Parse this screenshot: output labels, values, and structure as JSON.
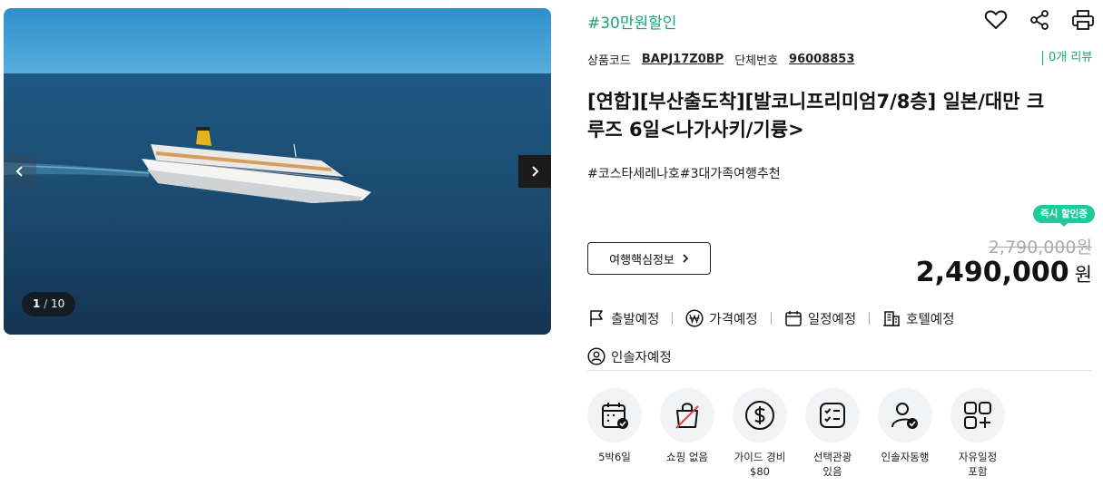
{
  "gallery": {
    "counter_current": "1",
    "counter_total": "10"
  },
  "promo": "#30만원할인",
  "top_icons": [
    "heart-icon",
    "share-icon",
    "print-icon"
  ],
  "codes": {
    "product_code_label": "상품코드",
    "product_code": "BAPJ17Z0BP",
    "group_no_label": "단체번호",
    "group_no": "96008853"
  },
  "review": "0개 리뷰",
  "title": "[연합][부산출도착][발코니프리미엄7/8층] 일본/대만 크루즈 6일<나가사키/기륭>",
  "hashtags": "#코스타세레나호#3대가족여행추천",
  "badge": "즉시 할인중",
  "info_button": "여행핵심정보",
  "original_price": "2,790,000원",
  "price": {
    "amount": "2,490,000",
    "unit": "원"
  },
  "schedule": [
    {
      "label": "출발예정",
      "icon": "flag-icon"
    },
    {
      "label": "가격예정",
      "icon": "won-icon"
    },
    {
      "label": "일정예정",
      "icon": "calendar-icon"
    },
    {
      "label": "호텔예정",
      "icon": "hotel-icon"
    },
    {
      "label": "인솔자예정",
      "icon": "person-icon"
    }
  ],
  "features": [
    {
      "label": "5박6일",
      "icon": "calendar-check-icon"
    },
    {
      "label": "쇼핑 없음",
      "icon": "no-shopping-icon"
    },
    {
      "label": "가이드 경비\n$80",
      "icon": "dollar-icon"
    },
    {
      "label": "선택관광\n있음",
      "icon": "checklist-icon"
    },
    {
      "label": "인솔자동행",
      "icon": "guide-icon"
    },
    {
      "label": "자유일정\n포함",
      "icon": "grid-plus-icon"
    }
  ],
  "colors": {
    "accent": "#1aa37a",
    "badge": "#1fc99a",
    "sea": "#1c4a6e"
  }
}
